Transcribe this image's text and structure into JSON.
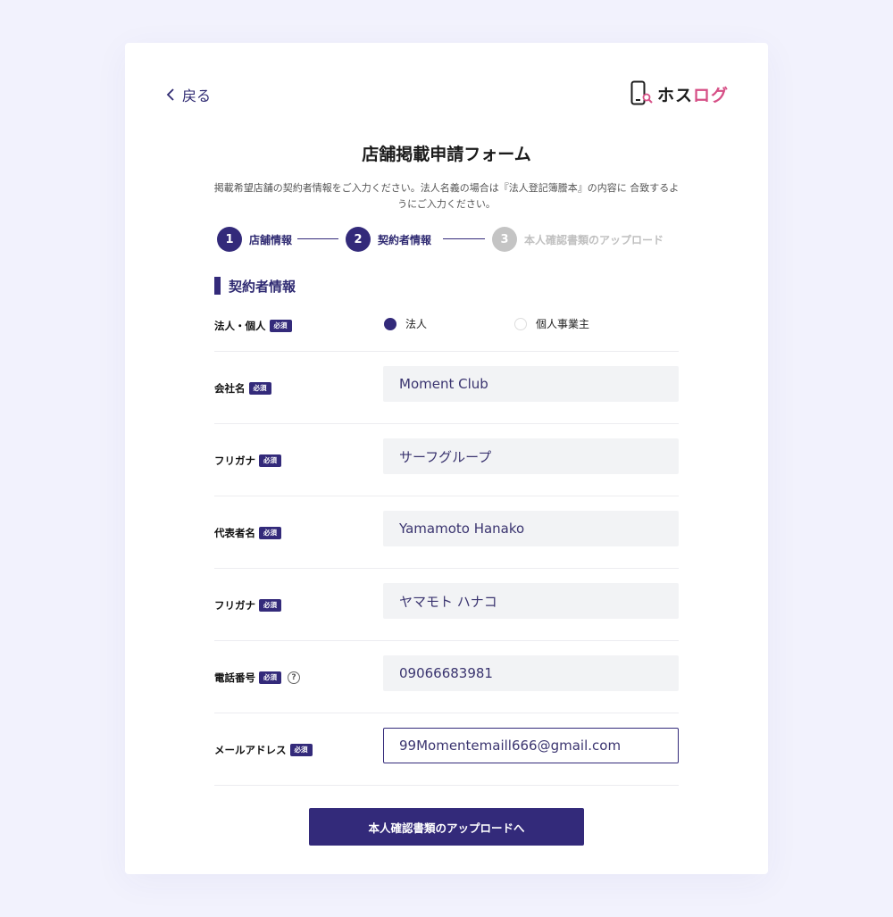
{
  "nav": {
    "back_label": "戻る"
  },
  "logo": {
    "text_dark": "ホス",
    "text_pink": "ログ"
  },
  "form": {
    "title": "店舗掲載申請フォーム",
    "description": "掲載希望店舗の契約者情報をご入力ください。法人名義の場合は『法人登記簿謄本』の内容に 合致するようにご入力ください。"
  },
  "steps": [
    {
      "number": "1",
      "label": "店舗情報",
      "state": "done"
    },
    {
      "number": "2",
      "label": "契約者情報",
      "state": "current"
    },
    {
      "number": "3",
      "label": "本人確認書類のアップロード",
      "state": "upcoming"
    }
  ],
  "section": {
    "title": "契約者情報"
  },
  "required_badge": "必須",
  "entity_type": {
    "label": "法人・個人",
    "options": [
      "法人",
      "個人事業主"
    ],
    "selected": "法人"
  },
  "fields": {
    "company_name": {
      "label": "会社名",
      "value": "Moment Club"
    },
    "company_kana": {
      "label": "フリガナ",
      "value": "サーフグループ"
    },
    "representative": {
      "label": "代表者名",
      "value": "Yamamoto Hanako"
    },
    "representative_kana": {
      "label": "フリガナ",
      "value": "ヤマモト ハナコ"
    },
    "phone": {
      "label": "電話番号",
      "value": "09066683981",
      "help": "?"
    },
    "email": {
      "label": "メールアドレス",
      "value": "99Momentemaill666@gmail.com"
    }
  },
  "submit_label": "本人確認書類のアップロードへ",
  "colors": {
    "primary": "#332a7a",
    "accent": "#d64f86",
    "background": "#f2f2fd",
    "field_bg": "#f2f3f5"
  }
}
